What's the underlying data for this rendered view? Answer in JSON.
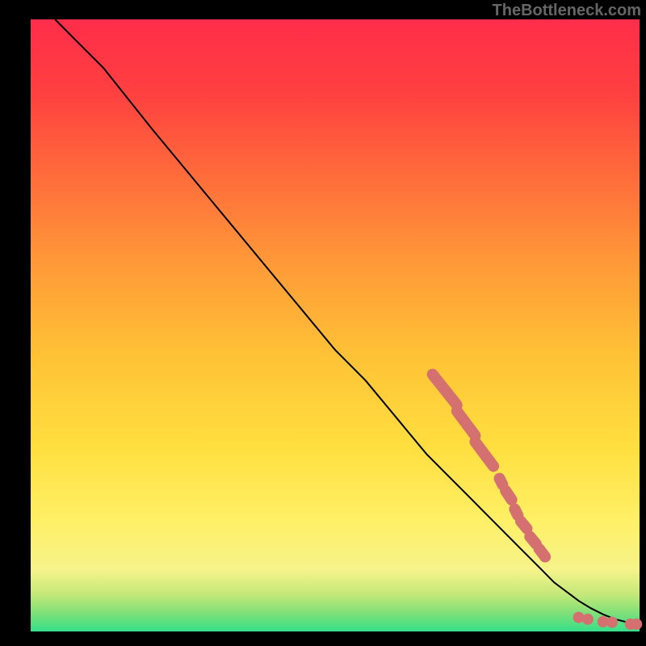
{
  "watermark": "TheBottleneck.com",
  "chart_data": {
    "type": "line",
    "title": "",
    "xlabel": "",
    "ylabel": "",
    "xlim": [
      0,
      100
    ],
    "ylim": [
      0,
      100
    ],
    "background_gradient": {
      "stops": [
        {
          "pos": 0.0,
          "color": "#35e08a"
        },
        {
          "pos": 0.03,
          "color": "#7fe078"
        },
        {
          "pos": 0.06,
          "color": "#c3e878"
        },
        {
          "pos": 0.1,
          "color": "#f5f38a"
        },
        {
          "pos": 0.18,
          "color": "#fff066"
        },
        {
          "pos": 0.3,
          "color": "#ffdf3f"
        },
        {
          "pos": 0.45,
          "color": "#ffc236"
        },
        {
          "pos": 0.6,
          "color": "#ff9a38"
        },
        {
          "pos": 0.75,
          "color": "#ff6a3b"
        },
        {
          "pos": 0.88,
          "color": "#ff4040"
        },
        {
          "pos": 1.0,
          "color": "#ff2d4a"
        }
      ]
    },
    "series": [
      {
        "name": "curve",
        "color": "#000000",
        "x": [
          4,
          8,
          12,
          16,
          20,
          25,
          30,
          35,
          40,
          45,
          50,
          55,
          60,
          65,
          68,
          72,
          76,
          80,
          84,
          86,
          88,
          90,
          92,
          94,
          96,
          98,
          99,
          100
        ],
        "y": [
          100,
          96,
          92,
          87,
          82,
          76,
          70,
          64,
          58,
          52,
          46,
          41,
          35,
          29,
          26,
          22,
          18,
          14,
          10,
          8,
          6.5,
          5,
          3.8,
          2.8,
          2.0,
          1.5,
          1.3,
          1.2
        ]
      }
    ],
    "markers": {
      "name": "highlight-segments",
      "color": "#d47070",
      "segments": [
        {
          "x1": 66,
          "y1": 42,
          "x2": 70,
          "y2": 37
        },
        {
          "x1": 70,
          "y1": 36,
          "x2": 73,
          "y2": 32
        },
        {
          "x1": 73,
          "y1": 31,
          "x2": 76,
          "y2": 27
        },
        {
          "x1": 77,
          "y1": 25,
          "x2": 77.5,
          "y2": 24
        },
        {
          "x1": 78,
          "y1": 23,
          "x2": 79,
          "y2": 21.5
        },
        {
          "x1": 79.5,
          "y1": 20,
          "x2": 80,
          "y2": 19
        },
        {
          "x1": 80.5,
          "y1": 18,
          "x2": 81.5,
          "y2": 16.8
        },
        {
          "x1": 82,
          "y1": 15.5,
          "x2": 83,
          "y2": 14.3
        },
        {
          "x1": 83.5,
          "y1": 13.5,
          "x2": 84.5,
          "y2": 12.2
        }
      ],
      "points": [
        {
          "x": 90,
          "y": 2.3
        },
        {
          "x": 91.5,
          "y": 2.0
        },
        {
          "x": 94,
          "y": 1.6
        },
        {
          "x": 95.5,
          "y": 1.5
        },
        {
          "x": 98.5,
          "y": 1.2
        },
        {
          "x": 99.5,
          "y": 1.2
        }
      ]
    }
  }
}
